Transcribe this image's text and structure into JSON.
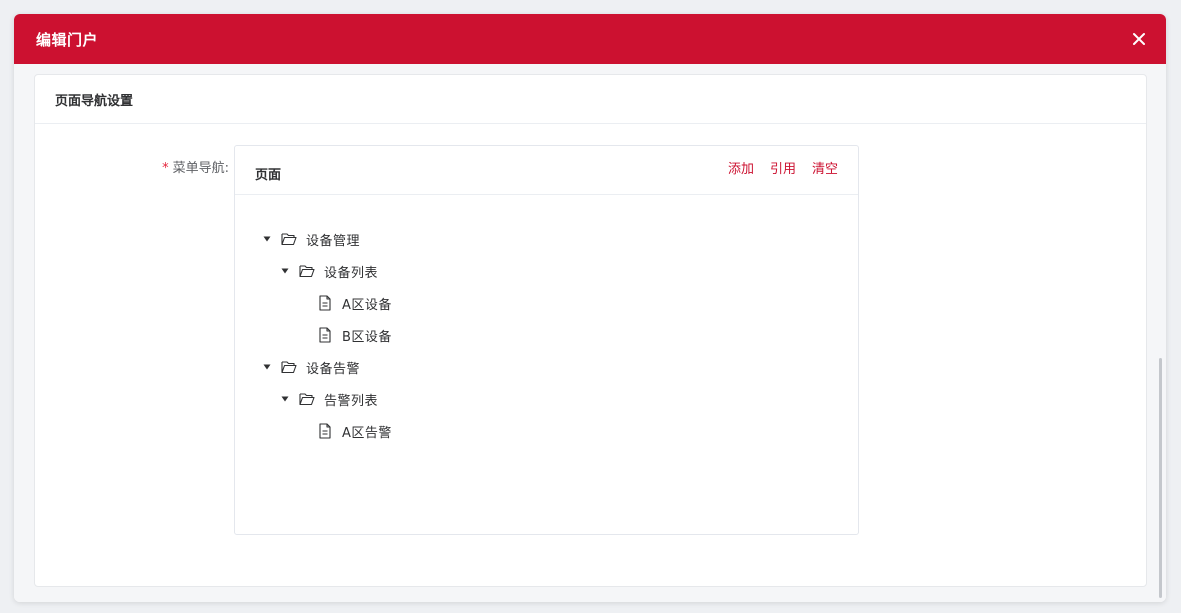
{
  "dialog": {
    "title": "编辑门户",
    "close_icon": "close-icon",
    "header_color": "#cc1130"
  },
  "card": {
    "title": "页面导航设置"
  },
  "form": {
    "required_mark": "*",
    "menu_nav_label": "菜单导航:"
  },
  "menu_box": {
    "title": "页面",
    "actions": {
      "add": "添加",
      "reference": "引用",
      "clear": "清空"
    },
    "accent_color": "#cc1130"
  },
  "tree": [
    {
      "label": "设备管理",
      "icon": "folder-open-icon",
      "expanded": true,
      "level": 0
    },
    {
      "label": "设备列表",
      "icon": "folder-open-icon",
      "expanded": true,
      "level": 1
    },
    {
      "label": "A区设备",
      "icon": "document-icon",
      "level": 2
    },
    {
      "label": "B区设备",
      "icon": "document-icon",
      "level": 2
    },
    {
      "label": "设备告警",
      "icon": "folder-open-icon",
      "expanded": true,
      "level": 0
    },
    {
      "label": "告警列表",
      "icon": "folder-open-icon",
      "expanded": true,
      "level": 1
    },
    {
      "label": "A区告警",
      "icon": "document-icon",
      "level": 2
    }
  ]
}
